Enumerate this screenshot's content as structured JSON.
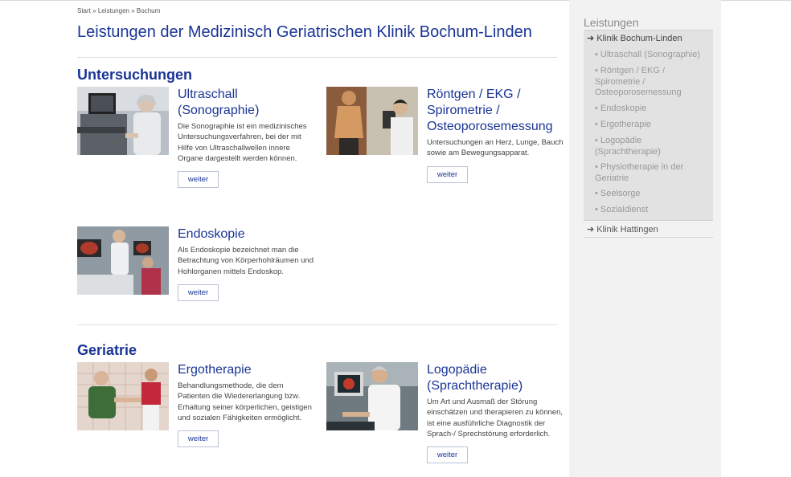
{
  "breadcrumb": {
    "items": [
      "Start",
      "Leistungen",
      "Bochum"
    ],
    "separator": "»"
  },
  "page_title": "Leistungen der Medizinisch Geriatrischen Klinik Bochum-Linden",
  "sections": [
    {
      "title": "Untersuchungen",
      "cards": [
        {
          "title": "Ultraschall (Sonographie)",
          "text": "Die Sonographie ist ein medizinisches Untersuchungsverfahren, bei der mit Hilfe von Ultraschallwellen innere Organe dargestellt werden können.",
          "button": "weiter",
          "image": "ultrasound-photo"
        },
        {
          "title": "Röntgen / EKG / Spirometrie / Osteoporosemessung",
          "text": "Untersuchungen an Herz, Lunge, Bauch sowie am Bewegungsapparat.",
          "button": "weiter",
          "image": "xray-photo"
        },
        {
          "title": "Endoskopie",
          "text": "Als Endoskopie bezeichnet man die Betrachtung von Körperhohlräumen und Hohlorganen mittels Endoskop.",
          "button": "weiter",
          "image": "endoscopy-photo"
        }
      ]
    },
    {
      "title": "Geriatrie",
      "cards": [
        {
          "title": "Ergotherapie",
          "text": "Behandlungsmethode, die dem Patienten die Wiedererlangung bzw. Erhaltung seiner körperlichen, geistigen und sozialen Fähigkeiten ermöglicht.",
          "button": "weiter",
          "image": "ergotherapy-photo"
        },
        {
          "title": "Logopädie (Sprachtherapie)",
          "text": "Um Art und Ausmaß der Störung einschätzen und therapieren zu können, ist eine ausführliche Diagnostik der Sprach-/ Sprechstörung erforderlich.",
          "button": "weiter",
          "image": "speech-therapy-photo"
        }
      ]
    }
  ],
  "sidebar": {
    "heading": "Leistungen",
    "active": "➜ Klinik Bochum-Linden",
    "subitems": [
      "• Ultraschall (Sonographie)",
      "• Röntgen / EKG / Spirometrie / Osteoporosemessung",
      "• Endoskopie",
      "• Ergotherapie",
      "• Logopädie (Sprachtherapie)",
      "• Physiotherapie in der Geriatrie",
      "• Seelsorge",
      "• Sozialdienst"
    ],
    "other": "➜ Klinik Hattingen"
  },
  "colors": {
    "accent": "#1a3596",
    "sidebar_bg": "#f2f2f2",
    "sidebar_active_bg": "#e2e2e2"
  }
}
